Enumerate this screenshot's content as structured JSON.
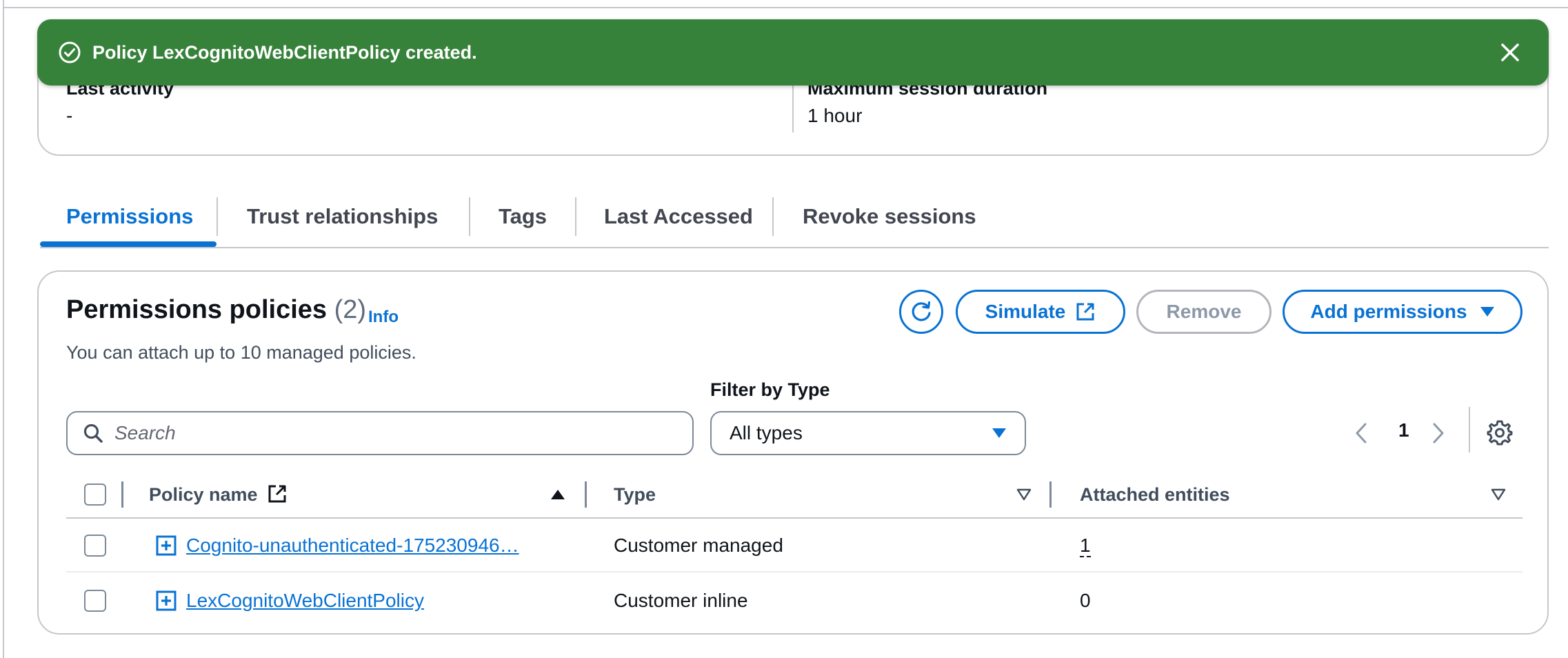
{
  "flash": {
    "message": "Policy LexCognitoWebClientPolicy created.",
    "color": "#37823b",
    "icon": "check-circle-icon",
    "close_icon": "close-icon"
  },
  "details": {
    "last_activity_label": "Last activity",
    "last_activity_value": "-",
    "max_session_label": "Maximum session duration",
    "max_session_value": "1 hour"
  },
  "tabs": [
    {
      "label": "Permissions",
      "active": true
    },
    {
      "label": "Trust relationships",
      "active": false
    },
    {
      "label": "Tags",
      "active": false
    },
    {
      "label": "Last Accessed",
      "active": false
    },
    {
      "label": "Revoke sessions",
      "active": false
    }
  ],
  "permissions": {
    "title": "Permissions policies",
    "count": "(2)",
    "info": "Info",
    "description": "You can attach up to 10 managed policies.",
    "buttons": {
      "refresh_icon": "refresh-icon",
      "simulate": "Simulate",
      "remove": "Remove",
      "add": "Add permissions"
    },
    "filter_label": "Filter by Type",
    "search_placeholder": "Search",
    "filter_value": "All types",
    "page": "1",
    "columns": {
      "policy_name": "Policy name",
      "type": "Type",
      "attached": "Attached entities"
    },
    "rows": [
      {
        "name": "Cognito-unauthenticated-175230946…",
        "type": "Customer managed",
        "attached": "1"
      },
      {
        "name": "LexCognitoWebClientPolicy",
        "type": "Customer inline",
        "attached": "0"
      }
    ]
  },
  "colors": {
    "accent": "#0972d3",
    "success": "#37823b",
    "border": "#c6c6cd",
    "text": "#0f141a"
  }
}
